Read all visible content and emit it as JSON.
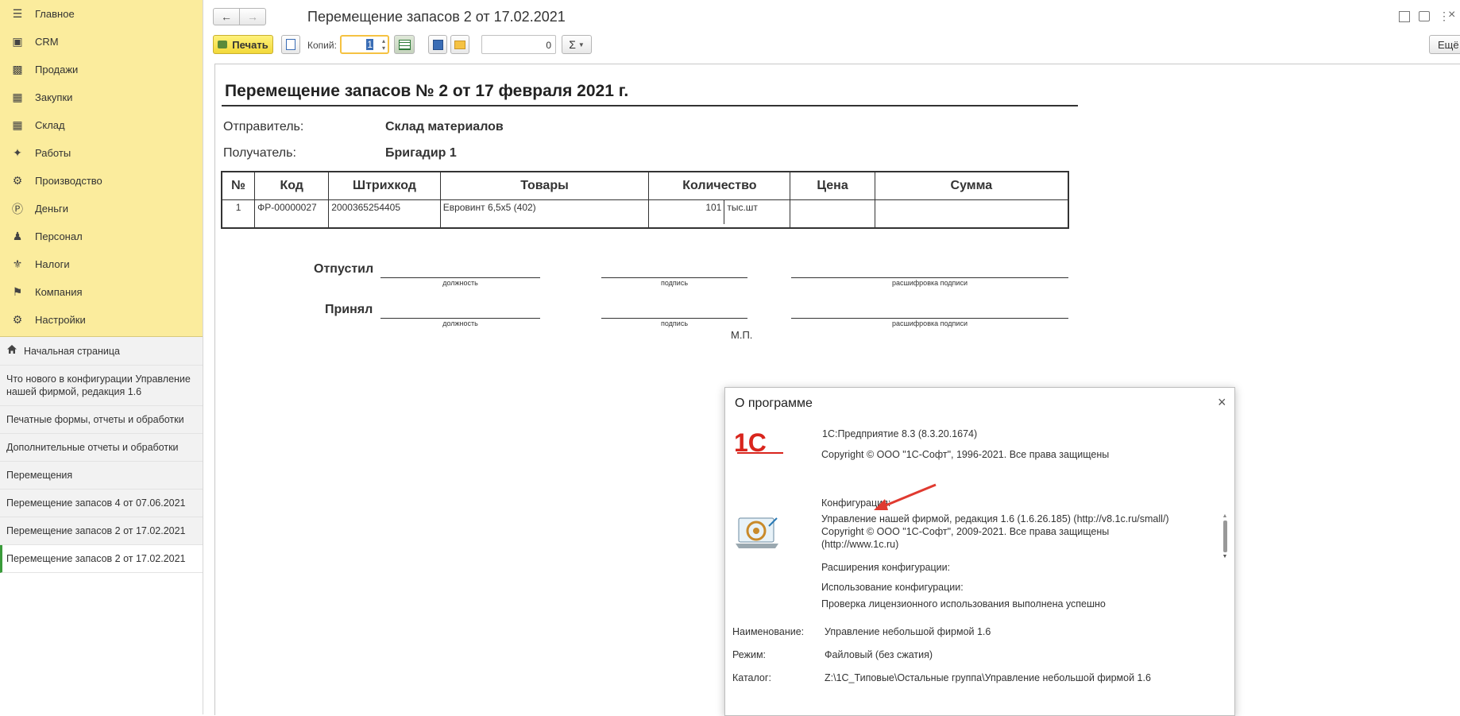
{
  "sidebar": {
    "nav": [
      {
        "label": "Главное",
        "icon": "menu-icon"
      },
      {
        "label": "CRM",
        "icon": "crm-icon"
      },
      {
        "label": "Продажи",
        "icon": "sales-icon"
      },
      {
        "label": "Закупки",
        "icon": "purchases-icon"
      },
      {
        "label": "Склад",
        "icon": "warehouse-icon"
      },
      {
        "label": "Работы",
        "icon": "tools-icon"
      },
      {
        "label": "Производство",
        "icon": "production-icon"
      },
      {
        "label": "Деньги",
        "icon": "money-icon"
      },
      {
        "label": "Персонал",
        "icon": "people-icon"
      },
      {
        "label": "Налоги",
        "icon": "tax-icon"
      },
      {
        "label": "Компания",
        "icon": "flag-icon"
      },
      {
        "label": "Настройки",
        "icon": "gear-icon"
      }
    ],
    "home": "Начальная страница",
    "open": [
      "Что нового в конфигурации Управление нашей фирмой, редакция 1.6",
      "Печатные формы, отчеты и обработки",
      "Дополнительные отчеты и обработки",
      "Перемещения",
      "Перемещение запасов 4 от 07.06.2021",
      "Перемещение запасов 2 от 17.02.2021",
      "Перемещение запасов 2 от 17.02.2021"
    ]
  },
  "window": {
    "title": "Перемещение запасов 2 от 17.02.2021",
    "more_label": "Ещё"
  },
  "toolbar": {
    "print_label": "Печать",
    "copies_label": "Копий:",
    "copies_value": "1",
    "sum_value": "0",
    "sigma": "Σ"
  },
  "document": {
    "heading": "Перемещение запасов № 2 от 17 февраля 2021 г.",
    "sender_label": "Отправитель:",
    "sender_value": "Склад материалов",
    "receiver_label": "Получатель:",
    "receiver_value": "Бригадир 1",
    "columns": [
      "№",
      "Код",
      "Штрихкод",
      "Товары",
      "Количество",
      "Цена",
      "Сумма"
    ],
    "rows": [
      {
        "n": "1",
        "code": "ФР-00000027",
        "barcode": "2000365254405",
        "item": "Евровинт 6,5х5 (402)",
        "qty": "101",
        "unit": "тыс.шт",
        "price": "",
        "sum": ""
      }
    ],
    "released_label": "Отпустил",
    "accepted_label": "Принял",
    "caption_position": "должность",
    "caption_signature": "подпись",
    "caption_decoding": "расшифровка подписи",
    "stamp": "М.П."
  },
  "about": {
    "title": "О программе",
    "platform": "1С:Предприятие 8.3 (8.3.20.1674)",
    "copyright": "Copyright © ООО \"1С-Софт\", 1996-2021. Все права защищены",
    "config_label": "Конфигурация:",
    "config_line1": "Управление нашей фирмой, редакция 1.6 (1.6.26.185) (http://v8.1c.ru/small/)",
    "config_line2": "Copyright © ООО \"1С-Софт\", 2009-2021. Все права защищены",
    "config_line3": "(http://www.1c.ru)",
    "extensions_label": "Расширения конфигурации:",
    "usage_label": "Использование конфигурации:",
    "usage_value": "Проверка лицензионного использования выполнена успешно",
    "name_label": "Наименование:",
    "name_value": "Управление небольшой фирмой 1.6",
    "mode_label": "Режим:",
    "mode_value": "Файловый (без сжатия)",
    "catalog_label": "Каталог:",
    "catalog_value": "Z:\\1С_Типовые\\Остальные группа\\Управление небольшой фирмой 1.6",
    "logo_text": "1С",
    "accent_color": "#d9251d"
  }
}
